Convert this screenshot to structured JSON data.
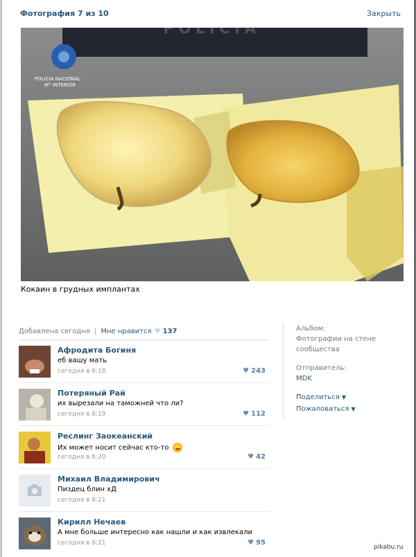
{
  "header": {
    "title": "Фотография 7 из 10",
    "close_label": "Закрыть"
  },
  "photo": {
    "alt": "Кокаин в грудных имплантах",
    "logo_line1": "POLICIA NACIONAL",
    "logo_line2": "M° INTERIOR",
    "box_text": "POLICIA"
  },
  "caption": "Кокаин в грудных имплантах",
  "meta": {
    "added": "Добавлена сегодня",
    "separator": "|",
    "like_label": "Мне нравится",
    "like_count": "137"
  },
  "sidebar": {
    "album_label": "Альбом:",
    "album_value": "Фотографии на стене сообщества",
    "sender_label": "Отправитель:",
    "sender_value": "MDK",
    "share_label": "Поделиться",
    "report_label": "Пожаловаться"
  },
  "comments": [
    {
      "author": "Афродита Богиня",
      "text": "еб вашу мать",
      "time": "сегодня в 8:18",
      "likes": "243"
    },
    {
      "author": "Потеряный Рай",
      "text": "их вырезали на таможней что ли?",
      "time": "сегодня в 8:19",
      "likes": "112"
    },
    {
      "author": "Реслинг Заокеанский",
      "text": "Их может носит сейчас кто-то",
      "time": "сегодня в 8:20",
      "likes": "42"
    },
    {
      "author": "Михаил Владимирович",
      "text": "Пиздец блин хД",
      "time": "сегодня в 8:21",
      "likes": ""
    },
    {
      "author": "Кирилл Нечаев",
      "text": "А мне больше интересно как нашли и как извлекали",
      "time": "сегодня в 8:21",
      "likes": "95"
    }
  ],
  "watermark": "pikabu.ru",
  "colors": {
    "link": "#2b587a",
    "muted": "#777777",
    "divider": "#dae1e8"
  }
}
